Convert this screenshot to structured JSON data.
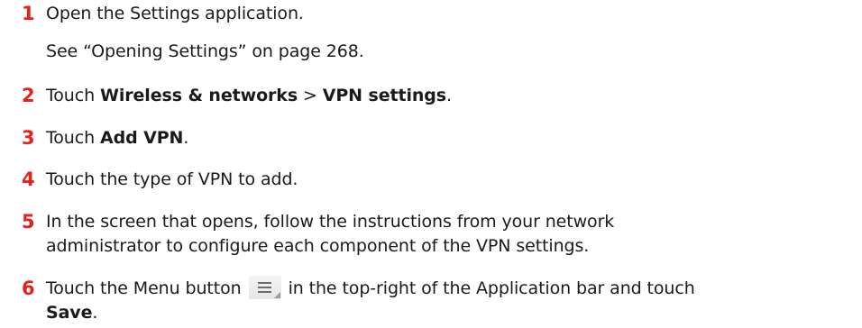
{
  "steps": [
    {
      "num": "1",
      "text": "Open the Settings application.",
      "note": "See “Opening Settings” on page 268."
    },
    {
      "num": "2",
      "pre": "Touch ",
      "b1": "Wireless & networks",
      "mid": " > ",
      "b2": "VPN settings",
      "post": "."
    },
    {
      "num": "3",
      "pre": "Touch ",
      "b1": "Add VPN",
      "post": "."
    },
    {
      "num": "4",
      "text": "Touch the type of VPN to add."
    },
    {
      "num": "5",
      "line1": "In the screen that opens, follow the instructions from your network",
      "line2": "administrator to configure each component of the VPN settings."
    },
    {
      "num": "6",
      "pre": "Touch the Menu button",
      "post": "in the top-right of the Application bar and touch",
      "b1": "Save",
      "end": ".",
      "icon": "menu-icon"
    }
  ]
}
